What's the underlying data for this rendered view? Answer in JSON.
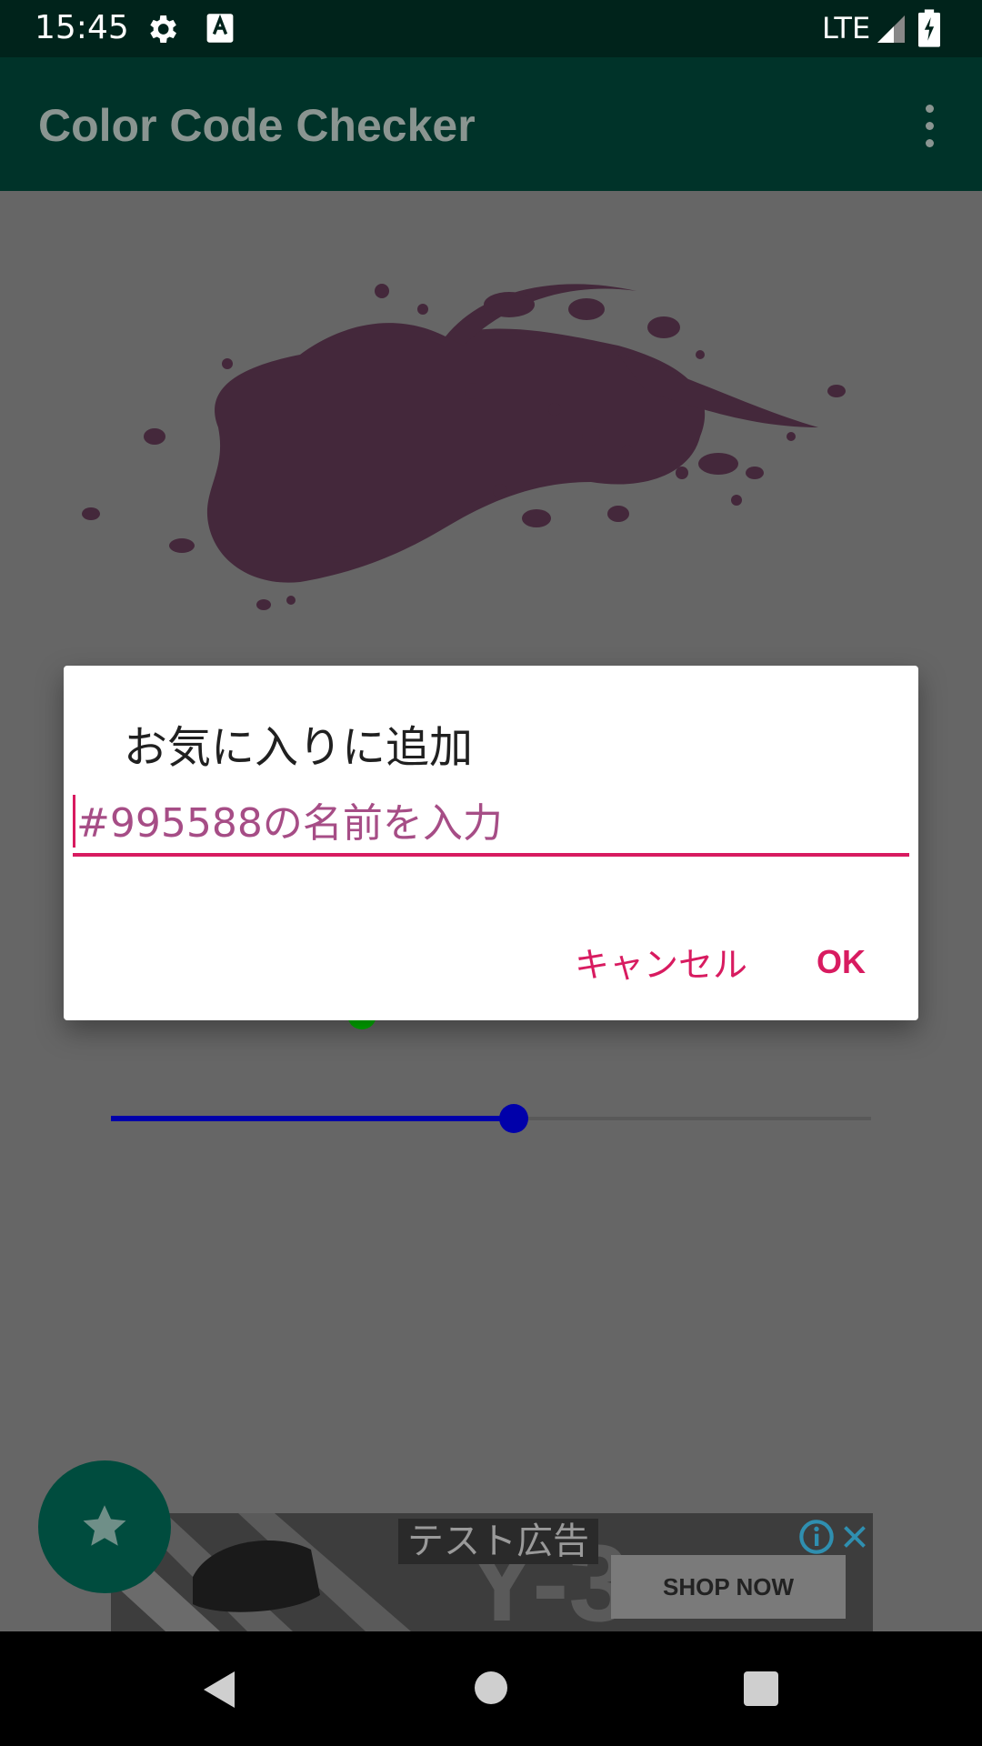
{
  "status_bar": {
    "time": "15:45",
    "network": "LTE"
  },
  "app_bar": {
    "title": "Color Code Checker"
  },
  "content": {
    "color_hex": "#995588",
    "sliders": [
      {
        "name": "green",
        "color": "#00b300",
        "fraction": 0.33
      },
      {
        "name": "blue",
        "color": "#0000aa",
        "fraction": 0.53
      }
    ]
  },
  "ad": {
    "label": "テスト広告",
    "cta": "SHOP NOW"
  },
  "dialog": {
    "title": "お気に入りに追加",
    "input_value": "",
    "input_placeholder": "#995588の名前を入力",
    "cancel_label": "キャンセル",
    "ok_label": "OK"
  },
  "colors": {
    "accent": "#d81b60",
    "primary_dark": "#003329",
    "scrim": "#666666"
  }
}
